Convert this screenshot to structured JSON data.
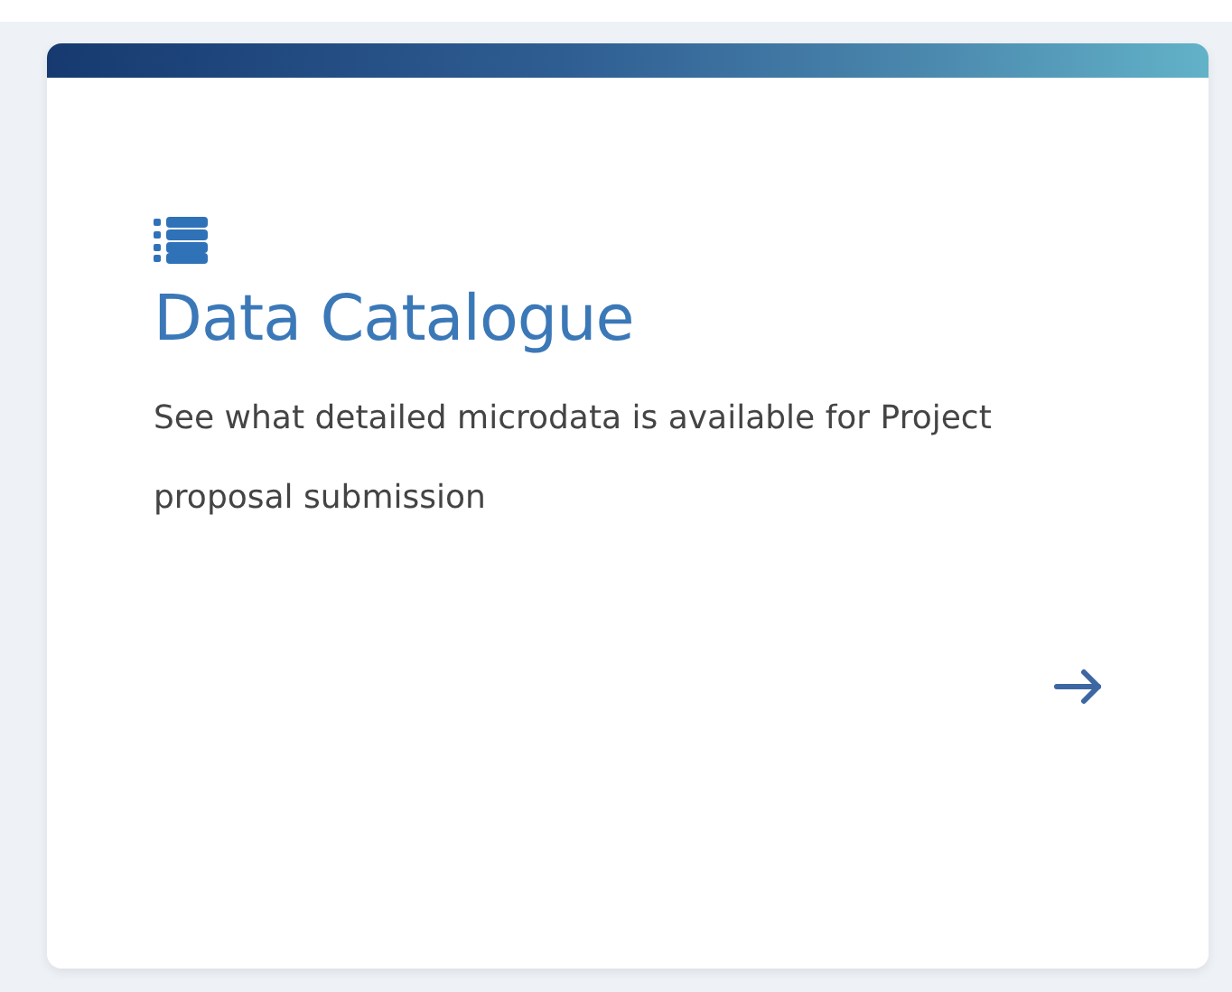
{
  "card": {
    "title": "Data Catalogue",
    "description": "See what detailed microdata is available for Project proposal submission"
  }
}
